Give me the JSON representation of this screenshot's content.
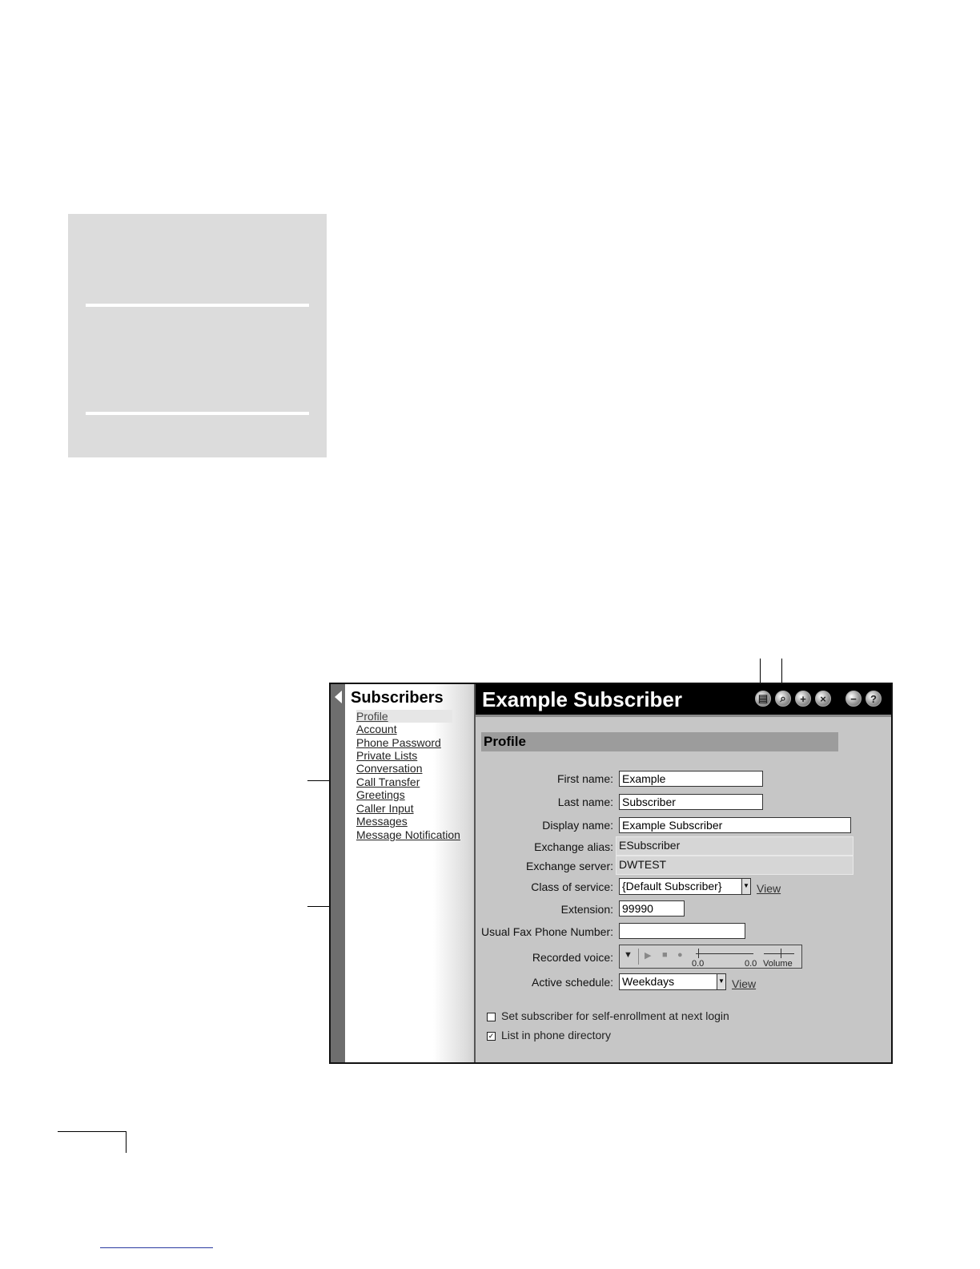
{
  "window": {
    "nav_title": "Subscribers",
    "page_title": "Example Subscriber",
    "toolbar": [
      {
        "name": "save-icon",
        "glyph": "▤"
      },
      {
        "name": "find-icon",
        "glyph": "⌕"
      },
      {
        "name": "add-icon",
        "glyph": "+"
      },
      {
        "name": "delete-icon",
        "glyph": "×"
      },
      {
        "name": "minimize-icon",
        "glyph": "−"
      },
      {
        "name": "help-icon",
        "glyph": "?"
      }
    ]
  },
  "nav": {
    "items": [
      "Profile",
      "Account",
      "Phone Password",
      "Private Lists",
      "Conversation",
      "Call Transfer",
      "Greetings",
      "Caller Input",
      "Messages",
      "Message Notification"
    ]
  },
  "form": {
    "section_title": "Profile",
    "first_name": {
      "label": "First name:",
      "value": "Example"
    },
    "last_name": {
      "label": "Last name:",
      "value": "Subscriber"
    },
    "display_name": {
      "label": "Display name:",
      "value": "Example Subscriber"
    },
    "exchange_alias": {
      "label": "Exchange alias:",
      "value": "ESubscriber"
    },
    "exchange_server": {
      "label": "Exchange server:",
      "value": "DWTEST"
    },
    "class_of_service": {
      "label": "Class of service:",
      "value": "{Default Subscriber}",
      "link": "View"
    },
    "extension": {
      "label": "Extension:",
      "value": "99990"
    },
    "fax": {
      "label": "Usual Fax Phone Number:",
      "value": ""
    },
    "recorded_voice": {
      "label": "Recorded voice:",
      "position": "0.0",
      "length": "0.0",
      "volume_label": "Volume"
    },
    "active_schedule": {
      "label": "Active schedule:",
      "value": "Weekdays",
      "link": "View"
    },
    "self_enroll": {
      "label": "Set subscriber for self-enrollment at next login",
      "checked": false,
      "mark": ""
    },
    "list_directory": {
      "label": "List in phone directory",
      "checked": true,
      "mark": "✓"
    }
  }
}
